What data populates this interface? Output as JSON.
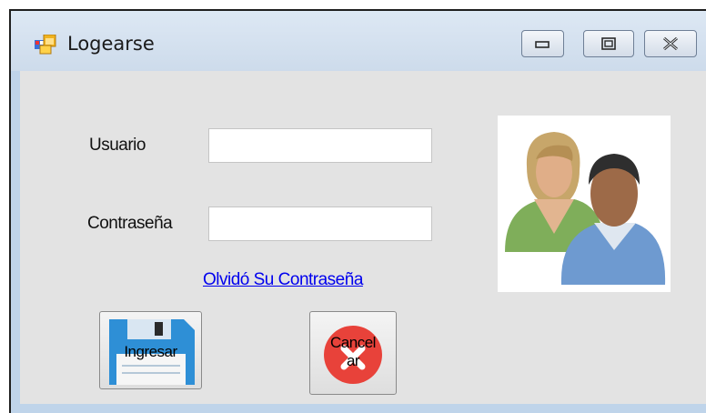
{
  "window": {
    "title": "Logearse"
  },
  "caption_buttons": {
    "minimize": "minimize",
    "maximize": "maximize",
    "close": "close"
  },
  "form": {
    "usuario_label": "Usuario",
    "usuario_value": "",
    "password_label": "Contraseña",
    "password_value": "",
    "forgot_link": "Olvidó Su Contraseña",
    "ingresar_label": "Ingresar",
    "cancelar_label_line1": "Cancel",
    "cancelar_label_line2": "ar"
  },
  "icons": {
    "app": "windows-form-icon",
    "users": "users-icon",
    "save": "floppy-disk-icon",
    "cancel": "red-x-circle-icon"
  },
  "colors": {
    "link": "#0000ee",
    "cancel_red": "#e8423a",
    "floppy_blue": "#2e8fd6"
  }
}
